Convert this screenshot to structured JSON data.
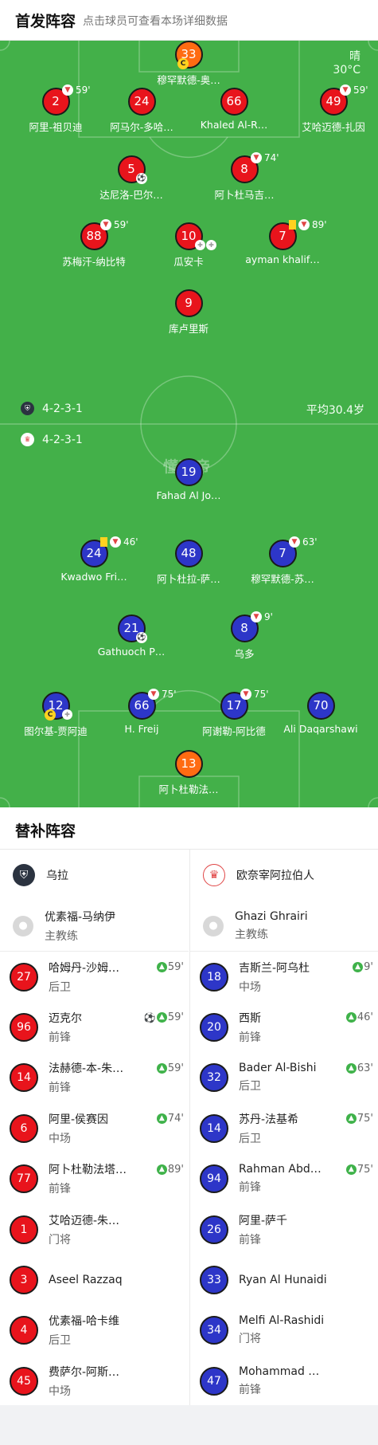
{
  "header": {
    "title": "首发阵容",
    "subtitle": "点击球员可查看本场详细数据"
  },
  "pitch": {
    "weather": "晴",
    "temperature": "30°C",
    "watermark": "懂球帝",
    "avg_age": "平均30.4岁",
    "home_formation": "4-2-3-1",
    "away_formation": "4-2-3-1",
    "colors": {
      "grass": "#43b049",
      "home": "#e8141c",
      "away": "#2d36c8",
      "keeper": "#ff6b12"
    }
  },
  "home_lineup": [
    {
      "num": "33",
      "name": "穆罕默德-奥…",
      "kit": "orange",
      "captain": true
    },
    {
      "num": "2",
      "name": "阿里-祖贝迪",
      "kit": "red",
      "sub_off": "59'"
    },
    {
      "num": "24",
      "name": "阿马尔-多哈…",
      "kit": "red"
    },
    {
      "num": "66",
      "name": "Khaled Al-R…",
      "kit": "red"
    },
    {
      "num": "49",
      "name": "艾哈迈德-扎因",
      "kit": "red",
      "sub_off": "59'"
    },
    {
      "num": "5",
      "name": "达尼洛-巴尔…",
      "kit": "red",
      "goal": true
    },
    {
      "num": "8",
      "name": "阿卜杜马吉…",
      "kit": "red",
      "sub_off": "74'"
    },
    {
      "num": "88",
      "name": "苏梅汗-纳比特",
      "kit": "red",
      "sub_off": "59'"
    },
    {
      "num": "10",
      "name": "瓜安卡",
      "kit": "red",
      "injury": 2
    },
    {
      "num": "7",
      "name": "ayman khalif…",
      "kit": "red",
      "yellow": true,
      "sub_off": "89'"
    },
    {
      "num": "9",
      "name": "库卢里斯",
      "kit": "red"
    }
  ],
  "away_lineup": [
    {
      "num": "19",
      "name": "Fahad Al Jo…",
      "kit": "blue"
    },
    {
      "num": "24",
      "name": "Kwadwo Fri…",
      "kit": "blue",
      "yellow": true,
      "sub_off": "46'"
    },
    {
      "num": "48",
      "name": "阿卜杜拉-萨…",
      "kit": "blue"
    },
    {
      "num": "7",
      "name": "穆罕默德-苏…",
      "kit": "blue",
      "sub_off": "63'"
    },
    {
      "num": "21",
      "name": "Gathuoch P…",
      "kit": "blue",
      "goal": true
    },
    {
      "num": "8",
      "name": "乌多",
      "kit": "blue",
      "sub_off": "9'"
    },
    {
      "num": "12",
      "name": "图尔基-贾阿迪",
      "kit": "blue",
      "captain": true,
      "injury": 1
    },
    {
      "num": "66",
      "name": "H. Freij",
      "kit": "blue",
      "sub_off": "75'"
    },
    {
      "num": "17",
      "name": "阿谢勒-阿比德",
      "kit": "blue",
      "sub_off": "75'"
    },
    {
      "num": "70",
      "name": "Ali Daqarshawi",
      "kit": "blue"
    },
    {
      "num": "13",
      "name": "阿卜杜勒法…",
      "kit": "orange"
    }
  ],
  "subs": {
    "title": "替补阵容",
    "home": {
      "team": "乌拉",
      "coach": "优素福-马纳伊",
      "coach_role": "主教练",
      "players": [
        {
          "num": "27",
          "name": "哈姆丹-沙姆…",
          "pos": "后卫",
          "on": "59'"
        },
        {
          "num": "96",
          "name": "迈克尔",
          "pos": "前锋",
          "on": "59'",
          "goal": true
        },
        {
          "num": "14",
          "name": "法赫德-本-朱…",
          "pos": "前锋",
          "on": "59'"
        },
        {
          "num": "6",
          "name": "阿里-侯赛因",
          "pos": "中场",
          "on": "74'"
        },
        {
          "num": "77",
          "name": "阿卜杜勒法塔…",
          "pos": "前锋",
          "on": "89'"
        },
        {
          "num": "1",
          "name": "艾哈迈德-朱…",
          "pos": "门将"
        },
        {
          "num": "3",
          "name": "Aseel Razzaq",
          "pos": ""
        },
        {
          "num": "4",
          "name": "优素福-哈卡维",
          "pos": "后卫"
        },
        {
          "num": "45",
          "name": "费萨尔-阿斯…",
          "pos": "中场"
        }
      ]
    },
    "away": {
      "team": "欧奈宰阿拉伯人",
      "coach": "Ghazi Ghrairi",
      "coach_role": "主教练",
      "players": [
        {
          "num": "18",
          "name": "吉斯兰-阿乌杜",
          "pos": "中场",
          "on": "9'"
        },
        {
          "num": "20",
          "name": "西斯",
          "pos": "前锋",
          "on": "46'"
        },
        {
          "num": "32",
          "name": "Bader Al-Bishi",
          "pos": "后卫",
          "on": "63'"
        },
        {
          "num": "14",
          "name": "苏丹-法基希",
          "pos": "后卫",
          "on": "75'"
        },
        {
          "num": "94",
          "name": "Rahman Abd…",
          "pos": "前锋",
          "on": "75'"
        },
        {
          "num": "26",
          "name": "阿里-萨千",
          "pos": "前锋"
        },
        {
          "num": "33",
          "name": "Ryan Al Hunaidi",
          "pos": ""
        },
        {
          "num": "34",
          "name": "Melfi Al-Rashidi",
          "pos": "门将"
        },
        {
          "num": "47",
          "name": "Mohammad …",
          "pos": "前锋"
        }
      ]
    }
  }
}
